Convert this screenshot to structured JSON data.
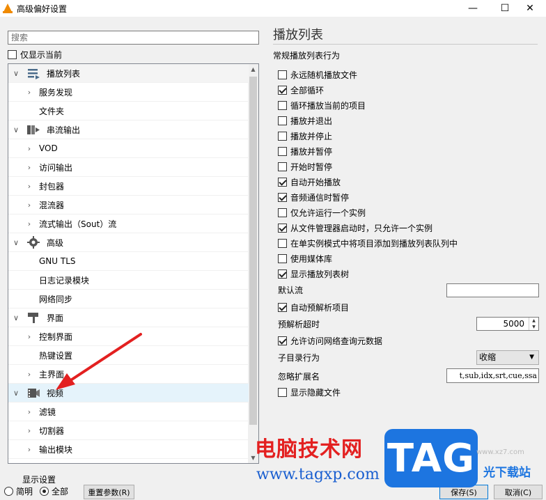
{
  "window": {
    "title": "高级偏好设置",
    "controls": [
      "—",
      "☐",
      "✕"
    ]
  },
  "left": {
    "search_placeholder": "搜索",
    "only_current_label": "仅显示当前",
    "only_current_checked": false,
    "tree": [
      {
        "label": "播放列表",
        "level": 0,
        "expander": "∨",
        "icon": "playlist-icon",
        "selected": false,
        "highlight": true
      },
      {
        "label": "服务发现",
        "level": 1,
        "expander": "›"
      },
      {
        "label": "文件夹",
        "level": 1,
        "expander": ""
      },
      {
        "label": "串流输出",
        "level": 0,
        "expander": "∨",
        "icon": "stream-output-icon"
      },
      {
        "label": "VOD",
        "level": 1,
        "expander": "›"
      },
      {
        "label": "访问输出",
        "level": 1,
        "expander": "›"
      },
      {
        "label": "封包器",
        "level": 1,
        "expander": "›"
      },
      {
        "label": "混流器",
        "level": 1,
        "expander": "›"
      },
      {
        "label": "流式输出（Sout）流",
        "level": 1,
        "expander": "›"
      },
      {
        "label": "高级",
        "level": 0,
        "expander": "∨",
        "icon": "advanced-gear-icon"
      },
      {
        "label": "GNU TLS",
        "level": 1,
        "expander": ""
      },
      {
        "label": "日志记录模块",
        "level": 1,
        "expander": ""
      },
      {
        "label": "网络同步",
        "level": 1,
        "expander": ""
      },
      {
        "label": "界面",
        "level": 0,
        "expander": "∨",
        "icon": "interface-brush-icon"
      },
      {
        "label": "控制界面",
        "level": 1,
        "expander": "›"
      },
      {
        "label": "热键设置",
        "level": 1,
        "expander": ""
      },
      {
        "label": "主界面",
        "level": 1,
        "expander": "›"
      },
      {
        "label": "视频",
        "level": 0,
        "expander": "∨",
        "icon": "video-icon",
        "selected": true
      },
      {
        "label": "滤镜",
        "level": 1,
        "expander": "›"
      },
      {
        "label": "切割器",
        "level": 1,
        "expander": "›"
      },
      {
        "label": "输出模块",
        "level": 1,
        "expander": "›"
      }
    ]
  },
  "right": {
    "section_title": "播放列表",
    "subtitle": "常规播放列表行为",
    "options": [
      {
        "label": "永远随机播放文件",
        "checked": false
      },
      {
        "label": "全部循环",
        "checked": true
      },
      {
        "label": "循环播放当前的项目",
        "checked": false
      },
      {
        "label": "播放并退出",
        "checked": false
      },
      {
        "label": "播放并停止",
        "checked": false
      },
      {
        "label": "播放并暂停",
        "checked": false
      },
      {
        "label": "开始时暂停",
        "checked": false
      },
      {
        "label": "自动开始播放",
        "checked": true
      },
      {
        "label": "音频通信时暂停",
        "checked": true
      },
      {
        "label": "仅允许运行一个实例",
        "checked": false
      },
      {
        "label": "从文件管理器启动时，只允许一个实例",
        "checked": true
      },
      {
        "label": "在单实例模式中将项目添加到播放列表队列中",
        "checked": false
      },
      {
        "label": "使用媒体库",
        "checked": false
      },
      {
        "label": "显示播放列表树",
        "checked": true
      }
    ],
    "default_stream_label": "默认流",
    "default_stream_value": "",
    "auto_preparse": {
      "label": "自动预解析项目",
      "checked": true
    },
    "preparse_timeout_label": "预解析超时",
    "preparse_timeout_value": "5000",
    "allow_metadata": {
      "label": "允许访问网络查询元数据",
      "checked": true
    },
    "subdir_behavior_label": "子目录行为",
    "subdir_behavior_value": "收缩",
    "ignore_ext_label": "忽略扩展名",
    "ignore_ext_value": "t,sub,idx,srt,cue,ssa",
    "show_hidden": {
      "label": "显示隐藏文件",
      "checked": false
    }
  },
  "footer": {
    "group_title": "显示设置",
    "radio_simple": "简明",
    "radio_all": "全部",
    "selected": "all",
    "reset_label": "重置参数(R)",
    "save_label": "保存(S)",
    "cancel_label": "取消(C)"
  },
  "watermark": {
    "site_name": "电脑技术网",
    "url": "www.tagxp.com",
    "tag": "TAG",
    "xz": "光下载站",
    "xz_small": "www.xz7.com"
  },
  "colors": {
    "selected_row": "#e5f3fb",
    "annotation_arrow": "#e32020",
    "tag_blue": "#1d75e0"
  }
}
